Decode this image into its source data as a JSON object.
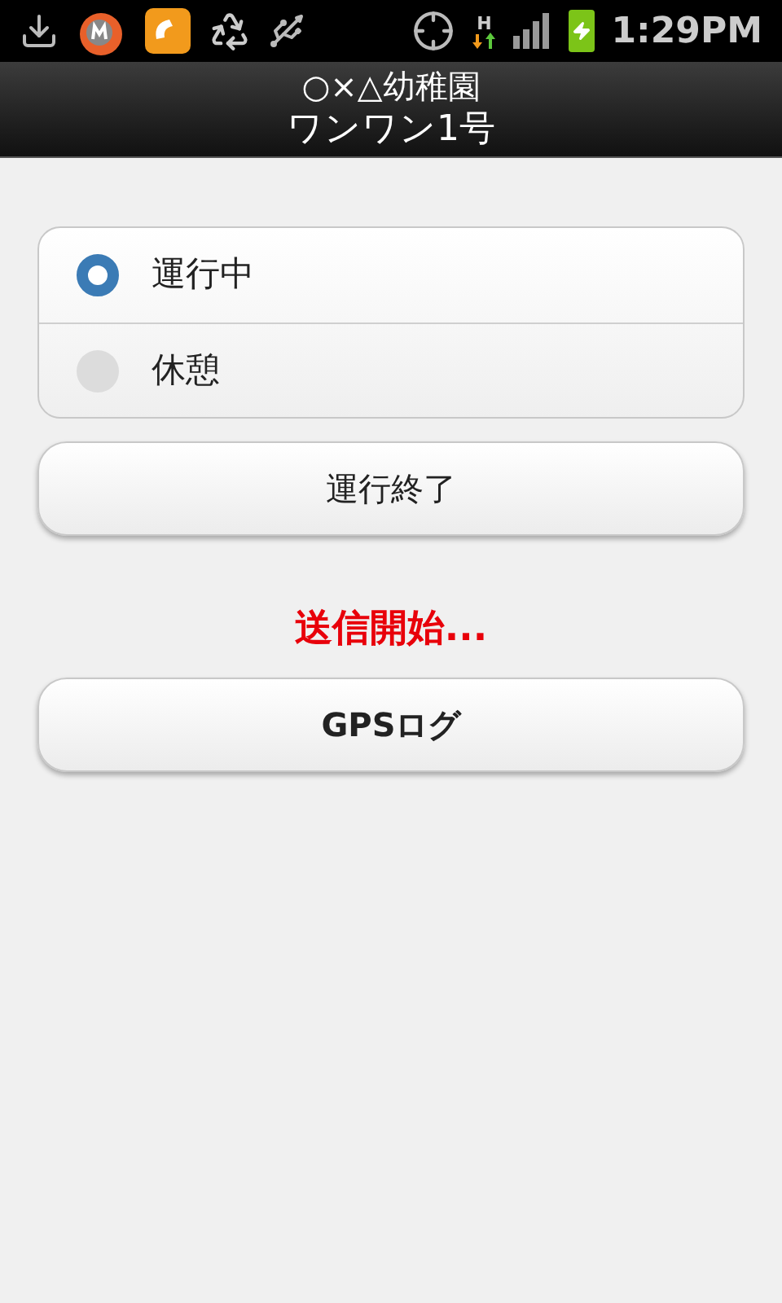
{
  "status_bar": {
    "network_type": "H",
    "time": "1:29PM"
  },
  "header": {
    "title": "○×△幼稚園",
    "subtitle": "ワンワン1号"
  },
  "status_options": [
    {
      "label": "運行中",
      "selected": true
    },
    {
      "label": "休憩",
      "selected": false
    }
  ],
  "end_button": "運行終了",
  "message": "送信開始...",
  "gps_button": "GPSログ"
}
